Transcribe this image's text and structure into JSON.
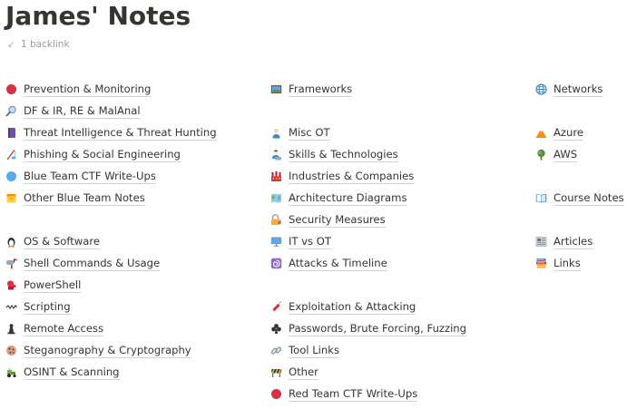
{
  "page": {
    "title": "James' Notes",
    "backlinks_label": "1 backlink"
  },
  "columns": [
    [
      {
        "label": "Prevention & Monitoring",
        "icon": "red-circle-icon",
        "slot": 0
      },
      {
        "label": "DF & IR, RE & MalAnal",
        "icon": "magnifying-glass-icon",
        "slot": 1
      },
      {
        "label": "Threat Intelligence & Threat Hunting",
        "icon": "purple-book-icon",
        "slot": 2
      },
      {
        "label": "Phishing & Social Engineering",
        "icon": "fishing-pole-icon",
        "slot": 3
      },
      {
        "label": "Blue Team CTF Write-Ups",
        "icon": "blue-circle-icon",
        "slot": 4
      },
      {
        "label": "Other Blue Team Notes",
        "icon": "file-cabinet-icon",
        "slot": 5
      },
      {
        "label": "OS & Software",
        "icon": "penguin-icon",
        "slot": 7
      },
      {
        "label": "Shell Commands & Usage",
        "icon": "mailbox-icon",
        "slot": 8
      },
      {
        "label": "PowerShell",
        "icon": "boxing-glove-icon",
        "slot": 9
      },
      {
        "label": "Scripting",
        "icon": "squiggle-icon",
        "slot": 10
      },
      {
        "label": "Remote Access",
        "icon": "chess-pawn-icon",
        "slot": 11
      },
      {
        "label": "Steganography & Cryptography",
        "icon": "cookie-icon",
        "slot": 12
      },
      {
        "label": "OSINT & Scanning",
        "icon": "tractor-icon",
        "slot": 13
      }
    ],
    [
      {
        "label": "Frameworks",
        "icon": "framed-picture-icon",
        "slot": 0
      },
      {
        "label": "Misc OT",
        "icon": "factory-worker-icon",
        "slot": 2
      },
      {
        "label": "Skills & Technologies",
        "icon": "technologist-icon",
        "slot": 3
      },
      {
        "label": "Industries & Companies",
        "icon": "factory-icon",
        "slot": 4
      },
      {
        "label": "Architecture Diagrams",
        "icon": "map-icon",
        "slot": 5
      },
      {
        "label": "Security Measures",
        "icon": "lock-with-key-icon",
        "slot": 6
      },
      {
        "label": "IT vs OT",
        "icon": "desktop-computer-icon",
        "slot": 7
      },
      {
        "label": "Attacks & Timeline",
        "icon": "cyclone-icon",
        "slot": 8
      },
      {
        "label": "Exploitation & Attacking",
        "icon": "firecracker-icon",
        "slot": 10
      },
      {
        "label": "Passwords, Brute Forcing, Fuzzing",
        "icon": "club-suit-icon",
        "slot": 11
      },
      {
        "label": "Tool Links",
        "icon": "link-icon",
        "slot": 12
      },
      {
        "label": "Other",
        "icon": "construction-barrier-icon",
        "slot": 13
      },
      {
        "label": "Red Team CTF Write-Ups",
        "icon": "red-circle-icon",
        "slot": 14
      }
    ],
    [
      {
        "label": "Networks",
        "icon": "globe-icon",
        "slot": 0
      },
      {
        "label": "Azure",
        "icon": "mountain-icon",
        "slot": 2
      },
      {
        "label": "AWS",
        "icon": "tree-icon",
        "slot": 3
      },
      {
        "label": "Course Notes",
        "icon": "open-book-icon",
        "slot": 5
      },
      {
        "label": "Articles",
        "icon": "newspaper-icon",
        "slot": 7
      },
      {
        "label": "Links",
        "icon": "books-icon",
        "slot": 8
      }
    ]
  ],
  "colors": {
    "text": "#37352f",
    "muted": "#9b9a97",
    "background": "#ffffff"
  }
}
